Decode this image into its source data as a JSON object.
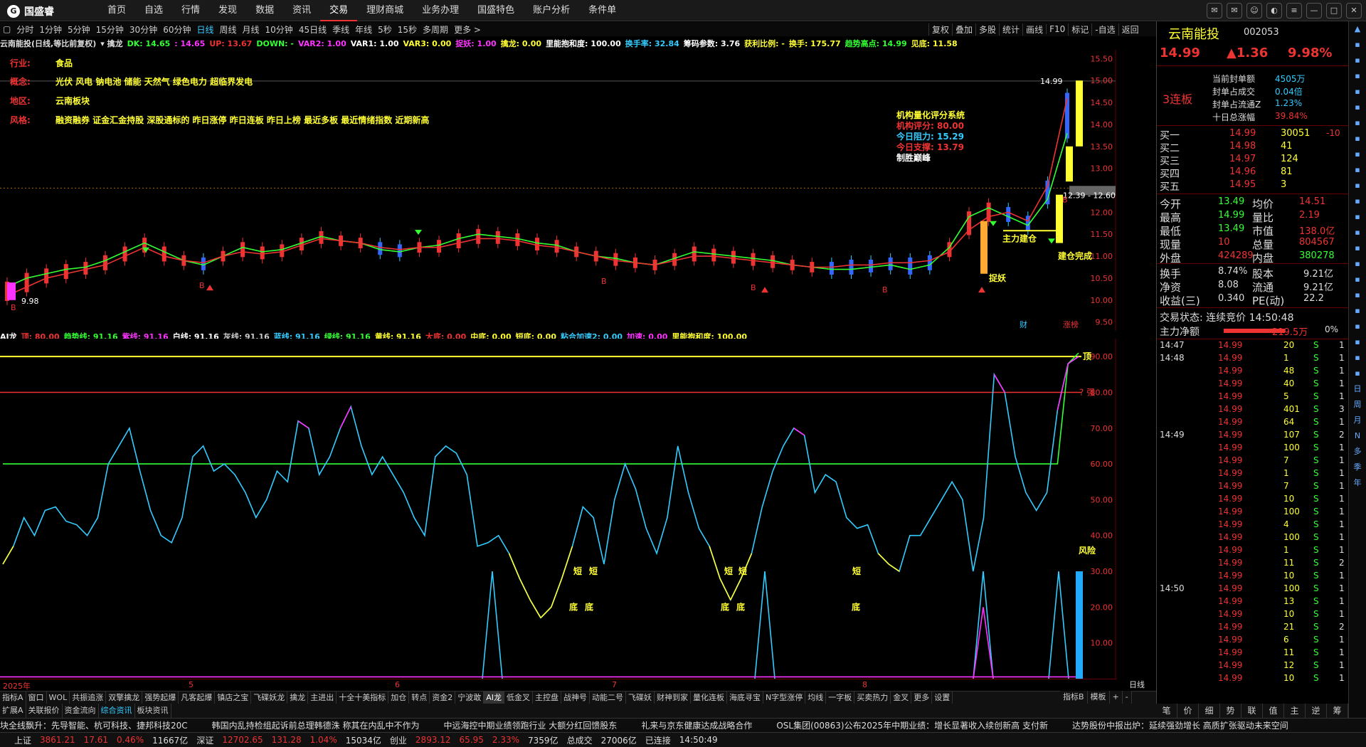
{
  "app": {
    "logo": "国盛睿"
  },
  "menu": [
    "首页",
    "自选",
    "行情",
    "发现",
    "数据",
    "资讯",
    "交易",
    "理财商城",
    "业务办理",
    "国盛特色",
    "账户分析",
    "条件单"
  ],
  "menu_active": "交易",
  "periods": [
    "分时",
    "1分钟",
    "5分钟",
    "15分钟",
    "30分钟",
    "60分钟",
    "日线",
    "周线",
    "月线",
    "10分钟",
    "45日线",
    "季线",
    "年线",
    "5秒",
    "15秒",
    "多周期",
    "更多 >"
  ],
  "period_active": "日线",
  "period_right": [
    "复权",
    "叠加",
    "多股",
    "统计",
    "画线",
    "F10",
    "标记",
    "-自选",
    "返回"
  ],
  "indicator_line": [
    {
      "t": "云南能投(日线,等比前复权)",
      "c": "#ddd"
    },
    {
      "t": "▾ 擒龙",
      "c": "#ddd"
    },
    {
      "t": "DK: 14.65",
      "c": "#3f3"
    },
    {
      "t": ": 14.65",
      "c": "#f3f"
    },
    {
      "t": "UP: 13.67",
      "c": "#e33"
    },
    {
      "t": "DOWN: -",
      "c": "#3f3"
    },
    {
      "t": "VAR2: 1.00",
      "c": "#f3f"
    },
    {
      "t": "VAR1: 1.00",
      "c": "#fff"
    },
    {
      "t": "VAR3: 0.00",
      "c": "#ff3"
    },
    {
      "t": "捉妖: 1.00",
      "c": "#f3f"
    },
    {
      "t": "擒龙: 0.00",
      "c": "#ff3"
    },
    {
      "t": "里能抱和度: 100.00",
      "c": "#fff"
    },
    {
      "t": "换手率: 32.84",
      "c": "#3cf"
    },
    {
      "t": "筹码参数: 3.76",
      "c": "#fff"
    },
    {
      "t": "获利比例: -",
      "c": "#ff3"
    },
    {
      "t": "换手: 175.77",
      "c": "#ff3"
    },
    {
      "t": "趋势高点: 14.99",
      "c": "#3f3"
    },
    {
      "t": "见底: 11.58",
      "c": "#ff3"
    }
  ],
  "info": [
    {
      "k": "行业:",
      "v": "食品"
    },
    {
      "k": "概念:",
      "v": "光伏 风电 钠电池 储能 天然气 绿色电力 超临界发电"
    },
    {
      "k": "地区:",
      "v": "云南板块"
    },
    {
      "k": "风格:",
      "v": "融资融券 证金汇金持股 深股通标的 昨日涨停 昨日连板 昨日上榜 最近多板 最近情绪指数 近期新高"
    }
  ],
  "jg": {
    "title": "机构量化评分系统",
    "rows": [
      {
        "t": "机构评分: 80.00",
        "c": "#e33"
      },
      {
        "t": "今日阻力: 15.29",
        "c": "#3cf"
      },
      {
        "t": "今日支撑: 13.79",
        "c": "#e33"
      },
      {
        "t": "制胜巅峰",
        "c": "#fff"
      }
    ]
  },
  "chart_annotations": {
    "high_label": "14.99",
    "low_label": "9.98",
    "range_label": "12.39 - 12.60",
    "zhuli": "主力建仓",
    "zhuoyao": "捉妖",
    "zhuoyao2": "捉妖",
    "jianshang": "建仓完成",
    "cai": "财",
    "zhang": "涨榜",
    "b": "B"
  },
  "ai_line": [
    {
      "t": "AI龙",
      "c": "#fff"
    },
    {
      "t": "顶: 80.00",
      "c": "#e33"
    },
    {
      "t": "趋势线: 91.16",
      "c": "#3f3"
    },
    {
      "t": "紫线: 91.16",
      "c": "#f3f"
    },
    {
      "t": "白线: 91.16",
      "c": "#fff"
    },
    {
      "t": "灰线: 91.16",
      "c": "#ccc"
    },
    {
      "t": "蓝线: 91.16",
      "c": "#3cf"
    },
    {
      "t": "绿线: 91.16",
      "c": "#3f3"
    },
    {
      "t": "黄线: 91.16",
      "c": "#ff3"
    },
    {
      "t": "大底: 0.00",
      "c": "#e33"
    },
    {
      "t": "中底: 0.00",
      "c": "#ff3"
    },
    {
      "t": "短底: 0.00",
      "c": "#ff3"
    },
    {
      "t": "粘合加速2: 0.00",
      "c": "#3cf"
    },
    {
      "t": "加速: 0.00",
      "c": "#f3f"
    },
    {
      "t": "里能抱和度: 100.00",
      "c": "#ff3"
    }
  ],
  "ai_annotations": {
    "top": "顶",
    "strong": "? 强",
    "risk": "风险",
    "short": "短",
    "bottom": "底"
  },
  "chart_data": [
    {
      "type": "line",
      "y_ticks": [
        15.5,
        15.0,
        14.5,
        14.0,
        13.5,
        13.0,
        12.5,
        12.0,
        11.5,
        11.0,
        10.5,
        10.0,
        9.5
      ],
      "ylim": [
        9.3,
        15.7
      ],
      "x_labels": [
        "2025年",
        "5",
        "6",
        "7",
        "8"
      ],
      "series": [
        {
          "name": "DK",
          "values": [
            10.3,
            10.5,
            10.6,
            10.7,
            10.75,
            10.9,
            11.1,
            11.3,
            11.1,
            10.9,
            10.8,
            11.0,
            11.2,
            11.1,
            11.15,
            11.3,
            11.45,
            11.35,
            11.3,
            11.15,
            11.1,
            11.2,
            11.25,
            11.4,
            11.5,
            11.45,
            11.4,
            11.3,
            11.25,
            11.1,
            11.0,
            10.95,
            10.85,
            10.8,
            10.95,
            11.1,
            11.05,
            11.0,
            10.95,
            10.9,
            10.8,
            10.75,
            10.7,
            10.7,
            10.75,
            10.8,
            10.7,
            10.8,
            11.2,
            11.9,
            12.1,
            11.9,
            11.7,
            12.3,
            13.8
          ]
        },
        {
          "name": "UP",
          "values": [
            10.1,
            10.3,
            10.5,
            10.6,
            10.7,
            10.8,
            11.0,
            11.2,
            11.0,
            10.9,
            10.85,
            11.0,
            11.1,
            11.05,
            11.1,
            11.25,
            11.4,
            11.35,
            11.3,
            11.2,
            11.15,
            11.2,
            11.2,
            11.3,
            11.4,
            11.4,
            11.35,
            11.25,
            11.2,
            11.1,
            11.0,
            10.9,
            10.85,
            10.8,
            10.9,
            11.0,
            11.0,
            10.95,
            10.9,
            10.85,
            10.8,
            10.75,
            10.75,
            10.8,
            10.8,
            10.85,
            10.85,
            10.9,
            11.1,
            11.6,
            11.9,
            12.0,
            11.8,
            12.6,
            14.6
          ]
        }
      ]
    },
    {
      "type": "line",
      "y_ticks": [
        90,
        80,
        70,
        60,
        50,
        40,
        30,
        20,
        10
      ],
      "ylim": [
        0,
        95
      ],
      "series": [
        {
          "name": "蓝线",
          "values": [
            32,
            37,
            45,
            40,
            47,
            48,
            44,
            43,
            40,
            45,
            60,
            65,
            70,
            58,
            47,
            40,
            38,
            45,
            62,
            65,
            58,
            60,
            57,
            52,
            45,
            50,
            58,
            55,
            72,
            70,
            57,
            62,
            70,
            76,
            65,
            57,
            62,
            57,
            52,
            45,
            40,
            62,
            65,
            63,
            57,
            37,
            38,
            40,
            35,
            28,
            22,
            17,
            20,
            28,
            37,
            48,
            45,
            32,
            50,
            60,
            53,
            42,
            35,
            45,
            65,
            52,
            42,
            37,
            28,
            22,
            28,
            35,
            48,
            58,
            65,
            70,
            68,
            52,
            57,
            55,
            45,
            42,
            43,
            35,
            32,
            30,
            40,
            40,
            45,
            50,
            55,
            50,
            30,
            45,
            85,
            80,
            62,
            52,
            47,
            52,
            75,
            88,
            90
          ]
        },
        {
          "name": "绿线",
          "values": [
            60,
            60,
            60,
            60,
            60,
            60,
            60,
            60,
            60,
            60,
            60,
            60,
            60,
            60,
            60,
            60,
            60,
            60,
            60,
            60,
            60,
            60,
            60,
            60,
            60,
            60,
            60,
            60,
            60,
            60,
            60,
            60,
            60,
            60,
            60,
            60,
            60,
            60,
            60,
            60,
            60,
            60,
            60,
            60,
            60,
            60,
            60,
            60,
            60,
            60,
            60,
            60,
            60,
            60,
            60,
            60,
            60,
            60,
            60,
            60,
            60,
            60,
            60,
            60,
            60,
            60,
            60,
            60,
            60,
            60,
            60,
            60,
            60,
            60,
            60,
            60,
            60,
            60,
            60,
            60,
            60,
            60,
            60,
            60,
            60,
            60,
            60,
            60,
            60,
            60,
            60,
            60,
            60,
            60,
            60,
            60,
            60,
            60,
            60,
            60,
            60,
            88,
            91
          ]
        }
      ],
      "levels": {
        "top": 90,
        "danger": 80
      }
    }
  ],
  "tabs1": [
    "指标A",
    "窗口",
    "WOL",
    "共振追涨",
    "双擎擒龙",
    "强势起爆",
    "凡客起爆",
    "镇店之宝",
    "飞碟妖龙",
    "擒龙",
    "主进出",
    "十全十美指标",
    "加仓",
    "转点",
    "资金2",
    "宁波敢",
    "AI龙",
    "低金叉",
    "主控盘",
    "战神号",
    "动能二号",
    "飞碟妖",
    "财神到家",
    "量化连板",
    "海底寻宝",
    "N字型涨停",
    "均线",
    "一字板",
    "买卖热力",
    "金叉",
    "更多",
    "设置"
  ],
  "tabs1_right": [
    "指标B",
    "模板",
    "+",
    "-"
  ],
  "tabs2": [
    "扩展A",
    "关联报价",
    "资金流向",
    "综合资讯",
    "板块资讯"
  ],
  "tabs2_active": "综合资讯",
  "day_label": "日线",
  "ticker": [
    "块全线飘升：先导智能、杭可科技、捷邦科技20C",
    "韩国内乱持检组起诉前总理韩德洙 称其在内乱中不作为",
    "中远海控中期业绩领跑行业 大额分红回馈股东",
    "礼来与京东健康达成战略合作",
    "OSL集团(00863)公布2025年中期业绩：增长显著收入续创新高 支付新",
    "达势股份中报出炉：延续强劲增长 高质扩张驱动未来空间"
  ],
  "status": [
    {
      "t": "上证",
      "c": "#ddd"
    },
    {
      "t": "3861.21",
      "c": "#e33"
    },
    {
      "t": "17.61",
      "c": "#e33"
    },
    {
      "t": "0.46%",
      "c": "#e33"
    },
    {
      "t": "11667亿",
      "c": "#ddd"
    },
    {
      "t": "深证",
      "c": "#ddd"
    },
    {
      "t": "12702.65",
      "c": "#e33"
    },
    {
      "t": "131.28",
      "c": "#e33"
    },
    {
      "t": "1.04%",
      "c": "#e33"
    },
    {
      "t": "15034亿",
      "c": "#ddd"
    },
    {
      "t": "创业",
      "c": "#ddd"
    },
    {
      "t": "2893.12",
      "c": "#e33"
    },
    {
      "t": "65.95",
      "c": "#e33"
    },
    {
      "t": "2.33%",
      "c": "#e33"
    },
    {
      "t": "7359亿",
      "c": "#ddd"
    },
    {
      "t": "总成交",
      "c": "#ddd"
    },
    {
      "t": "27006亿",
      "c": "#ddd"
    },
    {
      "t": "已连接",
      "c": "#ddd"
    },
    {
      "t": "14:50:49",
      "c": "#ddd"
    }
  ],
  "quote": {
    "name": "云南能投",
    "code": "002053",
    "price": "14.99",
    "change": "▲1.36",
    "pct": "9.98%",
    "lianban": "3连板",
    "seal": [
      {
        "k": "当前封单额",
        "v": "4505万"
      },
      {
        "k": "封单占成交",
        "v": "0.04倍"
      },
      {
        "k": "封单占流通Z",
        "v": "1.23%"
      },
      {
        "k": "十日总涨幅",
        "v": "39.84%"
      }
    ],
    "bids": [
      {
        "n": "买一",
        "p": "14.99",
        "v": "30051",
        "d": "-10"
      },
      {
        "n": "买二",
        "p": "14.98",
        "v": "41",
        "d": ""
      },
      {
        "n": "买三",
        "p": "14.97",
        "v": "124",
        "d": ""
      },
      {
        "n": "买四",
        "p": "14.96",
        "v": "81",
        "d": ""
      },
      {
        "n": "买五",
        "p": "14.95",
        "v": "3",
        "d": ""
      }
    ],
    "stats": [
      {
        "a": "今开",
        "av": "13.49",
        "b": "均价",
        "bv": "14.51"
      },
      {
        "a": "最高",
        "av": "14.99",
        "b": "量比",
        "bv": "2.19"
      },
      {
        "a": "最低",
        "av": "13.49",
        "b": "市值",
        "bv": "138.0亿"
      },
      {
        "a": "现量",
        "av": "10",
        "b": "总量",
        "bv": "804567"
      },
      {
        "a": "外盘",
        "av": "424289",
        "b": "内盘",
        "bv": "380278"
      }
    ],
    "stats2": [
      {
        "a": "换手",
        "av": "8.74%",
        "b": "股本",
        "bv": "9.21亿"
      },
      {
        "a": "净资",
        "av": "8.08",
        "b": "流通",
        "bv": "9.21亿"
      },
      {
        "a": "收益(三)",
        "av": "0.340",
        "b": "PE(动)",
        "bv": "22.2"
      }
    ],
    "trade_state": "交易状态: 连续竞价 14:50:48",
    "net_label": "主力净额",
    "net_value": "219.5万",
    "net_pct": "0%",
    "ticks": [
      {
        "t": "14:47",
        "p": "14.99",
        "v": "20",
        "s": "S",
        "n": "1"
      },
      {
        "t": "14:48",
        "p": "14.99",
        "v": "1",
        "s": "S",
        "n": "1"
      },
      {
        "t": "",
        "p": "14.99",
        "v": "48",
        "s": "S",
        "n": "1"
      },
      {
        "t": "",
        "p": "14.99",
        "v": "40",
        "s": "S",
        "n": "1"
      },
      {
        "t": "",
        "p": "14.99",
        "v": "5",
        "s": "S",
        "n": "1"
      },
      {
        "t": "",
        "p": "14.99",
        "v": "401",
        "s": "S",
        "n": "3"
      },
      {
        "t": "",
        "p": "14.99",
        "v": "64",
        "s": "S",
        "n": "1"
      },
      {
        "t": "14:49",
        "p": "14.99",
        "v": "107",
        "s": "S",
        "n": "2"
      },
      {
        "t": "",
        "p": "14.99",
        "v": "100",
        "s": "S",
        "n": "1"
      },
      {
        "t": "",
        "p": "14.99",
        "v": "7",
        "s": "S",
        "n": "1"
      },
      {
        "t": "",
        "p": "14.99",
        "v": "1",
        "s": "S",
        "n": "1"
      },
      {
        "t": "",
        "p": "14.99",
        "v": "7",
        "s": "S",
        "n": "1"
      },
      {
        "t": "",
        "p": "14.99",
        "v": "10",
        "s": "S",
        "n": "1"
      },
      {
        "t": "",
        "p": "14.99",
        "v": "100",
        "s": "S",
        "n": "1"
      },
      {
        "t": "",
        "p": "14.99",
        "v": "4",
        "s": "S",
        "n": "1"
      },
      {
        "t": "",
        "p": "14.99",
        "v": "100",
        "s": "S",
        "n": "1"
      },
      {
        "t": "",
        "p": "14.99",
        "v": "1",
        "s": "S",
        "n": "1"
      },
      {
        "t": "",
        "p": "14.99",
        "v": "11",
        "s": "S",
        "n": "2"
      },
      {
        "t": "",
        "p": "14.99",
        "v": "10",
        "s": "S",
        "n": "1"
      },
      {
        "t": "14:50",
        "p": "14.99",
        "v": "100",
        "s": "S",
        "n": "1"
      },
      {
        "t": "",
        "p": "14.99",
        "v": "13",
        "s": "S",
        "n": "1"
      },
      {
        "t": "",
        "p": "14.99",
        "v": "10",
        "s": "S",
        "n": "1"
      },
      {
        "t": "",
        "p": "14.99",
        "v": "21",
        "s": "S",
        "n": "2"
      },
      {
        "t": "",
        "p": "14.99",
        "v": "6",
        "s": "S",
        "n": "1"
      },
      {
        "t": "",
        "p": "14.99",
        "v": "11",
        "s": "S",
        "n": "1"
      },
      {
        "t": "",
        "p": "14.99",
        "v": "12",
        "s": "S",
        "n": "1"
      },
      {
        "t": "",
        "p": "14.99",
        "v": "10",
        "s": "S",
        "n": "1"
      }
    ]
  },
  "right_tabs": [
    "笔",
    "价",
    "细",
    "势",
    "联",
    "值",
    "主",
    "逆",
    "筹"
  ],
  "sidebar": [
    "日",
    "周",
    "月",
    "N",
    "多",
    "季",
    "年"
  ]
}
